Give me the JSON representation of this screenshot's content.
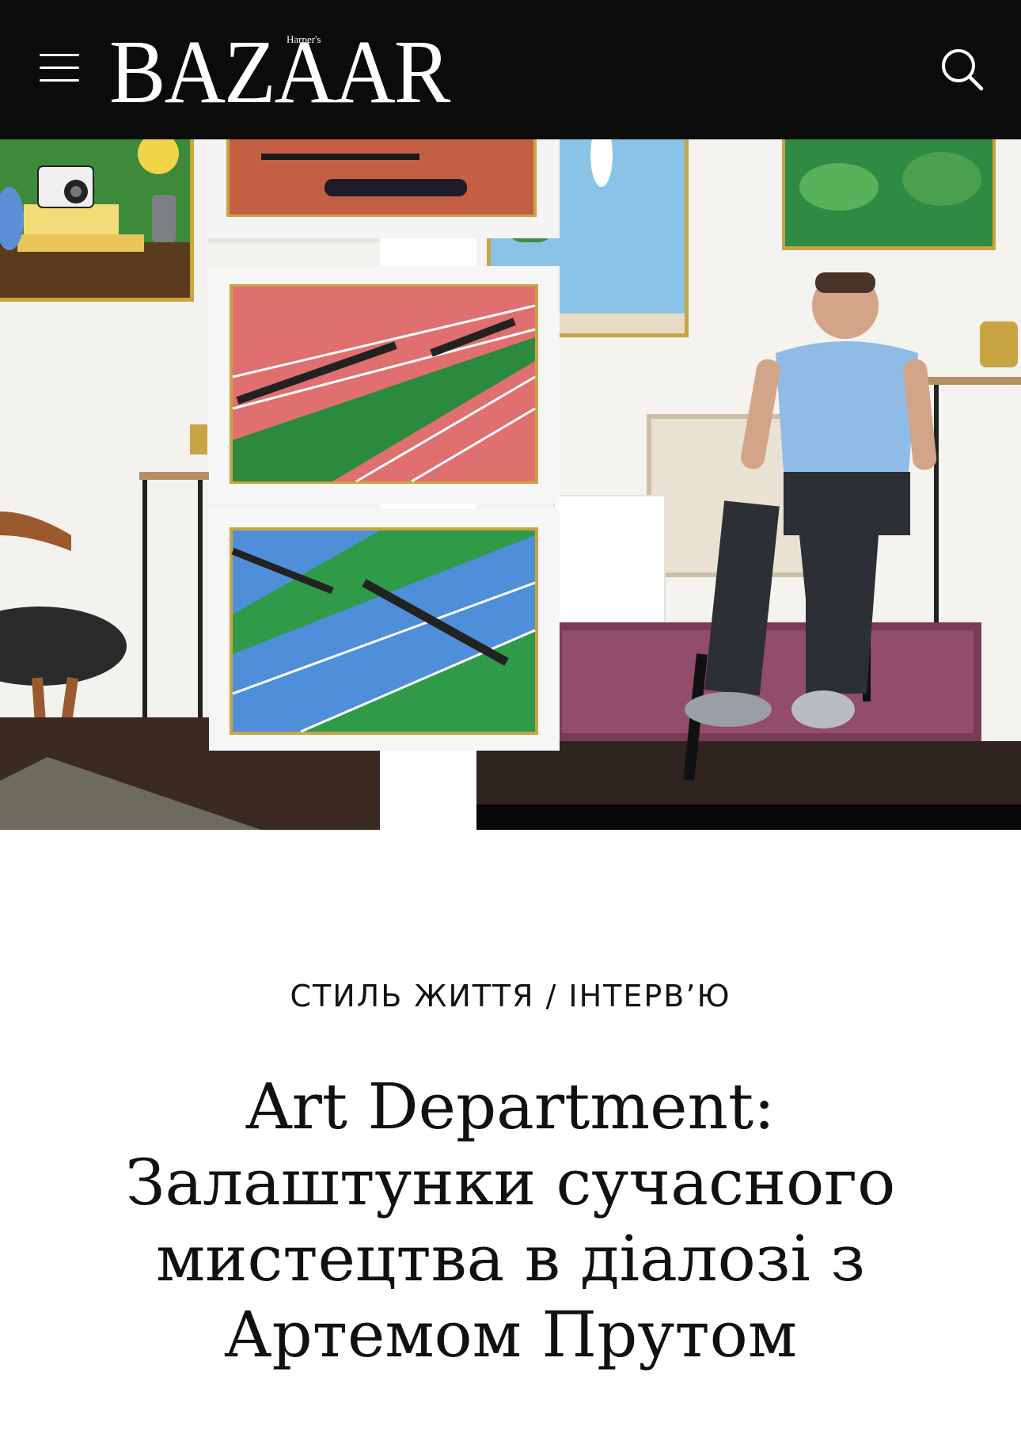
{
  "header": {
    "menu_icon": "hamburger-menu-icon",
    "logo_main": "BAZAAR",
    "logo_small": "Harper's",
    "search_icon": "search-icon",
    "background": "#0b0b0b"
  },
  "hero": {
    "description_icon": "hero-photo"
  },
  "article": {
    "category_primary": "СТИЛЬ ЖИТТЯ",
    "category_separator": "/",
    "category_secondary": "ІНТЕРВ’Ю",
    "title": "Art Department: Залаштунки сучасного мистецтва в діалозі з Артемом Прутом"
  }
}
